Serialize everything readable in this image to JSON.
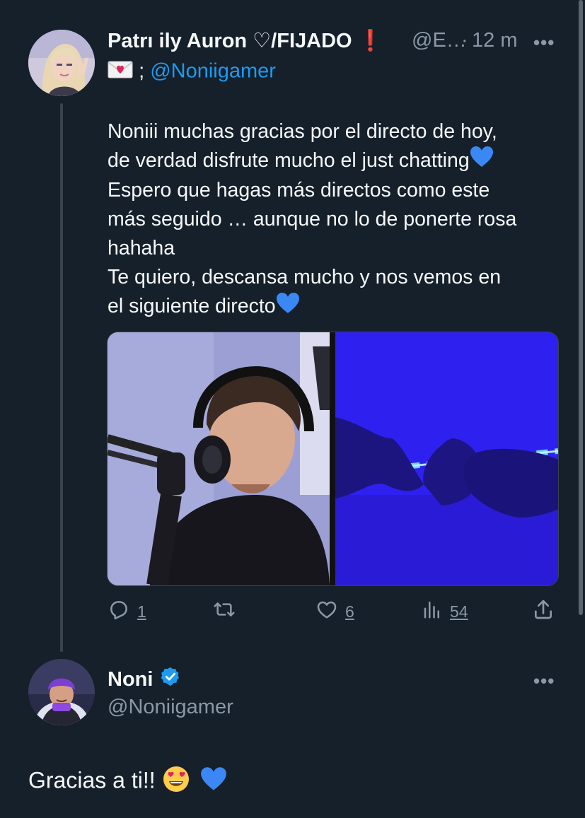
{
  "tweet": {
    "author_name": "Patrı ily Auron ♡/FIJADO",
    "author_handle": "@E…",
    "separator": "·",
    "time": "12 m",
    "bio_prefix": ";",
    "mention": "@Noniigamer",
    "more_label": "•••",
    "text_lines": [
      "Noniii muchas gracias por el directo de hoy,",
      "de verdad disfrute mucho el just chatting",
      "Espero que hagas más directos como este",
      "más seguido … aunque no lo de ponerte rosa",
      "hahaha",
      "Te quiero, descansa mucho y nos vemos en",
      "el siguiente directo"
    ],
    "media": [
      {
        "label": "photo-streamer-headset"
      },
      {
        "label": "photo-hands-heart-blue-light"
      }
    ],
    "stats": {
      "replies": "1",
      "retweets": "",
      "likes": "6",
      "views": "54"
    }
  },
  "reply": {
    "author_name": "Noni",
    "author_handle": "@Noniigamer",
    "more_label": "•••",
    "text": "Gracias a ti!!",
    "verified": true
  },
  "colors": {
    "background": "#15202b",
    "accent": "#1d9bf0",
    "muted": "#8b98a5",
    "text": "#f7f9f9"
  }
}
